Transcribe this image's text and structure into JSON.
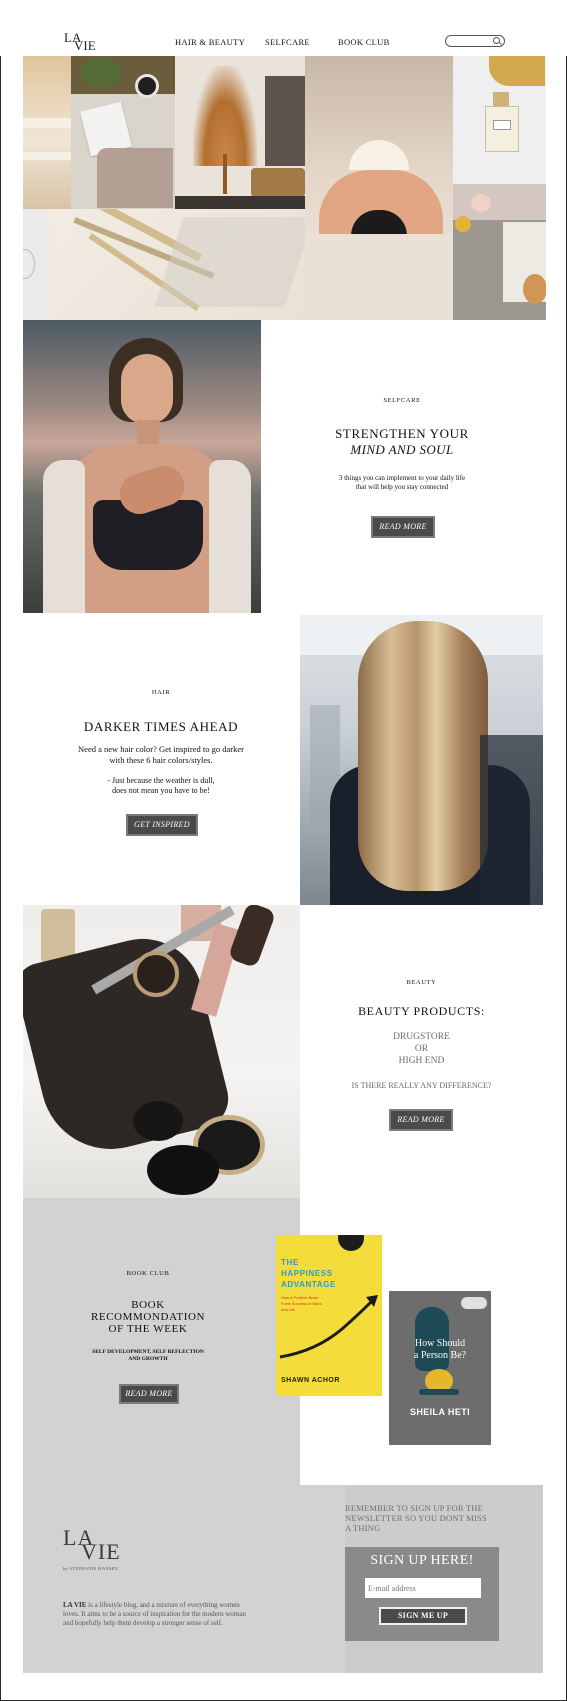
{
  "header": {
    "logo_top": "LA",
    "logo_bottom": "VIE",
    "nav": [
      "HAIR & BEAUTY",
      "SELFCARE",
      "BOOK CLUB"
    ],
    "search_placeholder": ""
  },
  "selfcare": {
    "kicker": "SELFCARE",
    "title": "STRENGTHEN YOUR",
    "title_italic": "MIND AND SOUL",
    "body_line1": "3 things you can implement to your daily life",
    "body_line2": "that will help you stay connected",
    "button": "READ MORE"
  },
  "hair": {
    "kicker": "HAIR",
    "title": "DARKER TIMES AHEAD",
    "lead_line1": "Need a new hair color? Get inspired to go darker",
    "lead_line2": "with these 6 hair colors/styles.",
    "quote_line1": "- Just because the weather is dull,",
    "quote_line2": "does not mean you have to be!",
    "button": "GET INSPIRED"
  },
  "beauty": {
    "kicker": "BEAUTY",
    "title": "BEAUTY PRODUCTS:",
    "line1": "DRUGSTORE",
    "line2": "OR",
    "line3": "HIGH END",
    "question": "IS THERE REALLY ANY DIFFERENCE?",
    "button": "READ MORE"
  },
  "bookclub": {
    "kicker": "BOOK CLUB",
    "title_line1": "BOOK",
    "title_line2": "RECOMMONDATION",
    "title_line3": "OF THE WEEK",
    "sub_line1": "SELF DEVELOPMENT, SELF REFLECTION",
    "sub_line2": "AND GROWTH",
    "button": "READ MORE",
    "book1": {
      "title_line1": "THE",
      "title_line2": "HAPPINESS",
      "title_line3": "ADVANTAGE",
      "subtitle": "How a Positive Brain Fuels Success in Work and Life",
      "author": "SHAWN ACHOR",
      "cover_color": "#f4dc3a"
    },
    "book2": {
      "title_line1": "How Should",
      "title_line2": "a Person Be?",
      "author": "SHEILA HETI",
      "cover_color": "#6d6d6d"
    }
  },
  "footer": {
    "logo_top": "LA",
    "logo_bottom": "VIE",
    "logo_byline": "by STEPHANIE HANSEN",
    "about_brand": "LA VIE",
    "about_text": " is a lifestyle blog, and a mixture of everything women loves. It aims to be a source of inspiration for the modern woman and hopefully help them develop a stronger sense of self.",
    "newsletter_line1": "REMEMBER TO SIGN UP FOR THE",
    "newsletter_line2": "NEWSLETTER SO YOU DONT MISS",
    "newsletter_line3": "A THING",
    "signup_title": "SIGN UP HERE!",
    "email_placeholder": "E-mail address",
    "signup_button": "SIGN ME UP"
  },
  "colors": {
    "button_bg": "#4a4a4a",
    "footer_bg": "#cccccc",
    "bookclub_bg": "#d2d2d2",
    "signup_box": "#8a8a8a"
  }
}
